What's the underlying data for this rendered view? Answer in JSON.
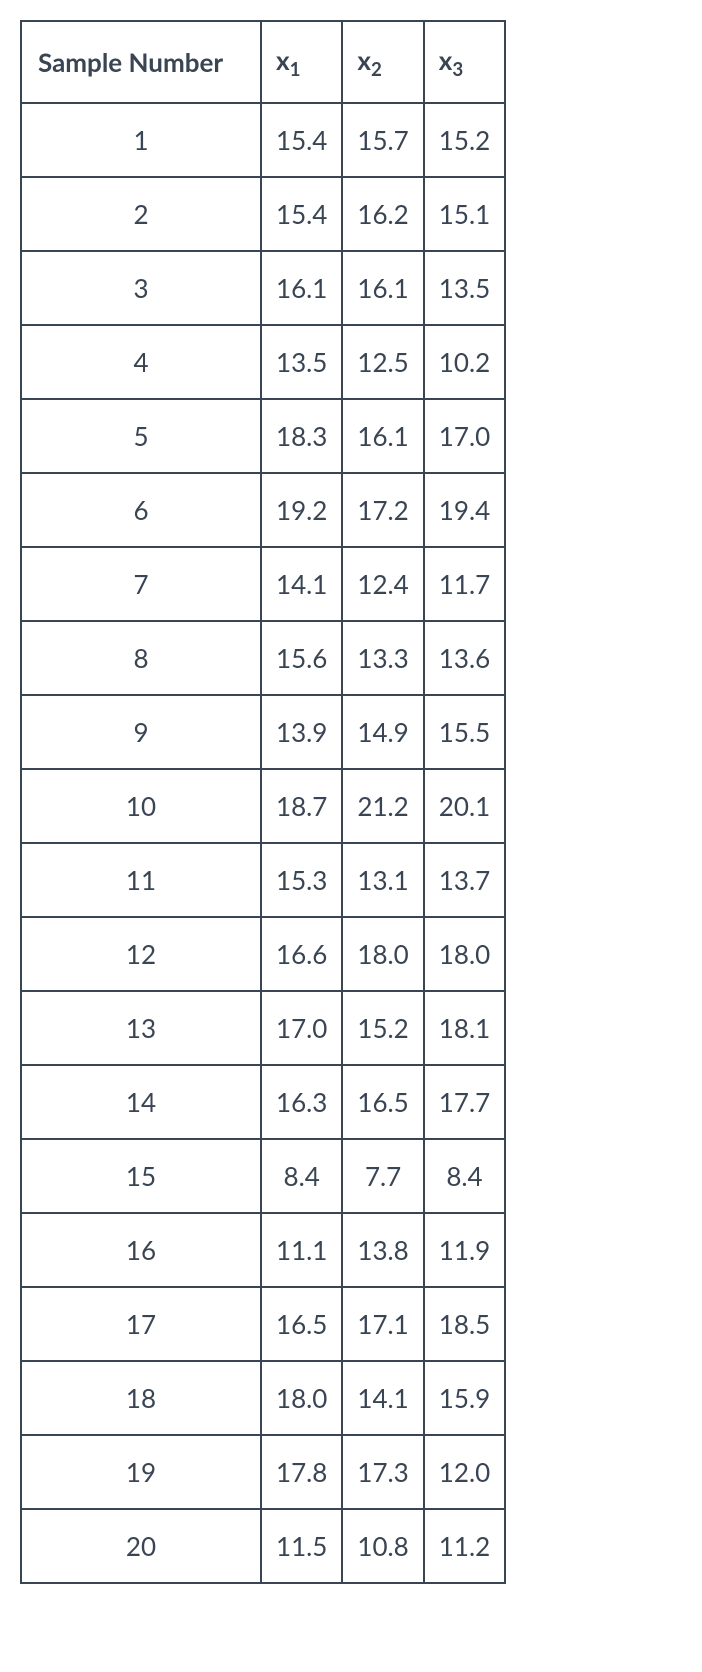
{
  "chart_data": {
    "type": "table",
    "columns": [
      "Sample Number",
      "x1",
      "x2",
      "x3"
    ],
    "rows": [
      {
        "sample": "1",
        "x1": "15.4",
        "x2": "15.7",
        "x3": "15.2"
      },
      {
        "sample": "2",
        "x1": "15.4",
        "x2": "16.2",
        "x3": "15.1"
      },
      {
        "sample": "3",
        "x1": "16.1",
        "x2": "16.1",
        "x3": "13.5"
      },
      {
        "sample": "4",
        "x1": "13.5",
        "x2": "12.5",
        "x3": "10.2"
      },
      {
        "sample": "5",
        "x1": "18.3",
        "x2": "16.1",
        "x3": "17.0"
      },
      {
        "sample": "6",
        "x1": "19.2",
        "x2": "17.2",
        "x3": "19.4"
      },
      {
        "sample": "7",
        "x1": "14.1",
        "x2": "12.4",
        "x3": "11.7"
      },
      {
        "sample": "8",
        "x1": "15.6",
        "x2": "13.3",
        "x3": "13.6"
      },
      {
        "sample": "9",
        "x1": "13.9",
        "x2": "14.9",
        "x3": "15.5"
      },
      {
        "sample": "10",
        "x1": "18.7",
        "x2": "21.2",
        "x3": "20.1"
      },
      {
        "sample": "11",
        "x1": "15.3",
        "x2": "13.1",
        "x3": "13.7"
      },
      {
        "sample": "12",
        "x1": "16.6",
        "x2": "18.0",
        "x3": "18.0"
      },
      {
        "sample": "13",
        "x1": "17.0",
        "x2": "15.2",
        "x3": "18.1"
      },
      {
        "sample": "14",
        "x1": "16.3",
        "x2": "16.5",
        "x3": "17.7"
      },
      {
        "sample": "15",
        "x1": "8.4",
        "x2": "7.7",
        "x3": "8.4"
      },
      {
        "sample": "16",
        "x1": "11.1",
        "x2": "13.8",
        "x3": "11.9"
      },
      {
        "sample": "17",
        "x1": "16.5",
        "x2": "17.1",
        "x3": "18.5"
      },
      {
        "sample": "18",
        "x1": "18.0",
        "x2": "14.1",
        "x3": "15.9"
      },
      {
        "sample": "19",
        "x1": "17.8",
        "x2": "17.3",
        "x3": "12.0"
      },
      {
        "sample": "20",
        "x1": "11.5",
        "x2": "10.8",
        "x3": "11.2"
      }
    ]
  },
  "headers": {
    "sample": "Sample Number",
    "x_base": "x",
    "x1_sub": "1",
    "x2_sub": "2",
    "x3_sub": "3"
  }
}
